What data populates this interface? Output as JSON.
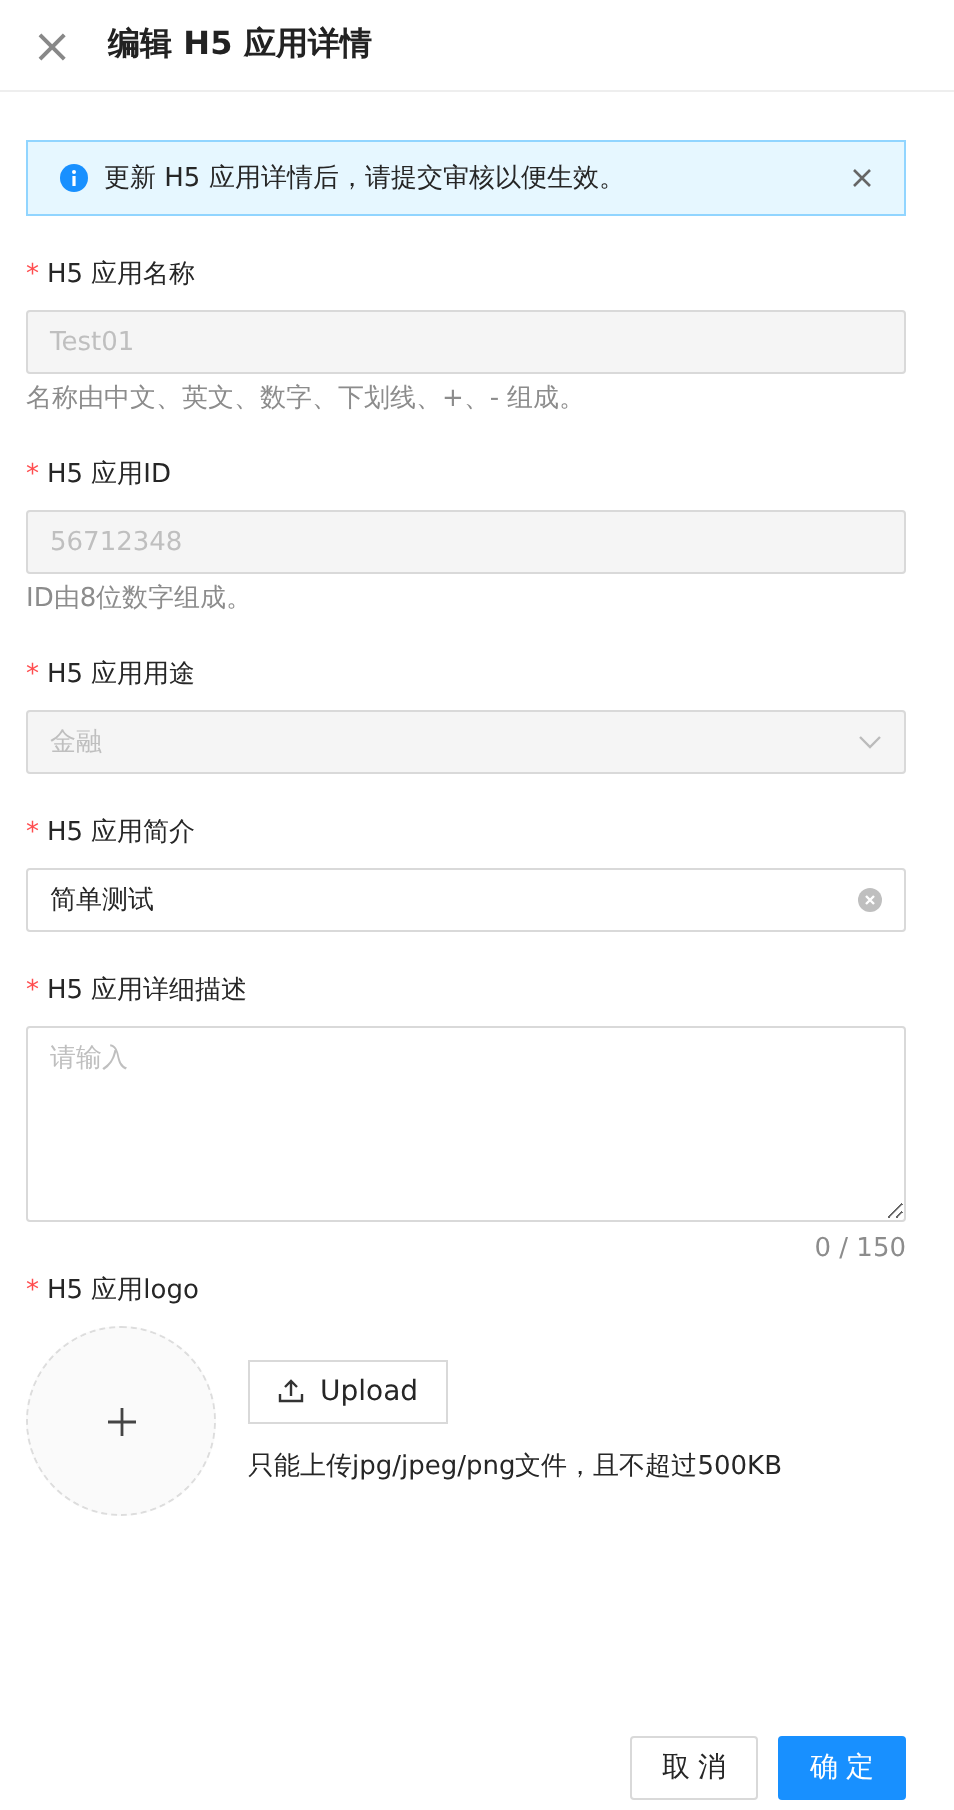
{
  "header": {
    "close": "×",
    "title": "编辑 H5 应用详情"
  },
  "alert": {
    "text": "更新 H5 应用详情后，请提交审核以便生效。",
    "closable": true
  },
  "fields": [
    {
      "kind": "input",
      "label": "H5 应用名称",
      "required": "*",
      "value": "Test01",
      "disabled": true,
      "help": "名称由中文、英文、数字、下划线、+、- 组成。"
    },
    {
      "kind": "input",
      "label": "H5 应用ID",
      "required": "*",
      "value": "56712348",
      "disabled": true,
      "help": "ID由8位数字组成。"
    },
    {
      "kind": "select",
      "label": "H5 应用用途",
      "required": "*",
      "value": "金融",
      "disabled": true
    },
    {
      "kind": "input",
      "label": "H5 应用简介",
      "required": "*",
      "value": "简单测试",
      "disabled": false,
      "clearable": true
    },
    {
      "kind": "textarea",
      "label": "H5 应用详细描述",
      "required": "*",
      "placeholder": "请输入",
      "counter": "0 / 150"
    },
    {
      "kind": "upload",
      "label": "H5 应用logo",
      "required": "*",
      "button": "Upload",
      "hint": "只能上传jpg/jpeg/png文件，且不超过500KB"
    }
  ],
  "buttons": [
    {
      "label": "取 消",
      "primary": false
    },
    {
      "label": "确 定",
      "primary": true
    }
  ]
}
